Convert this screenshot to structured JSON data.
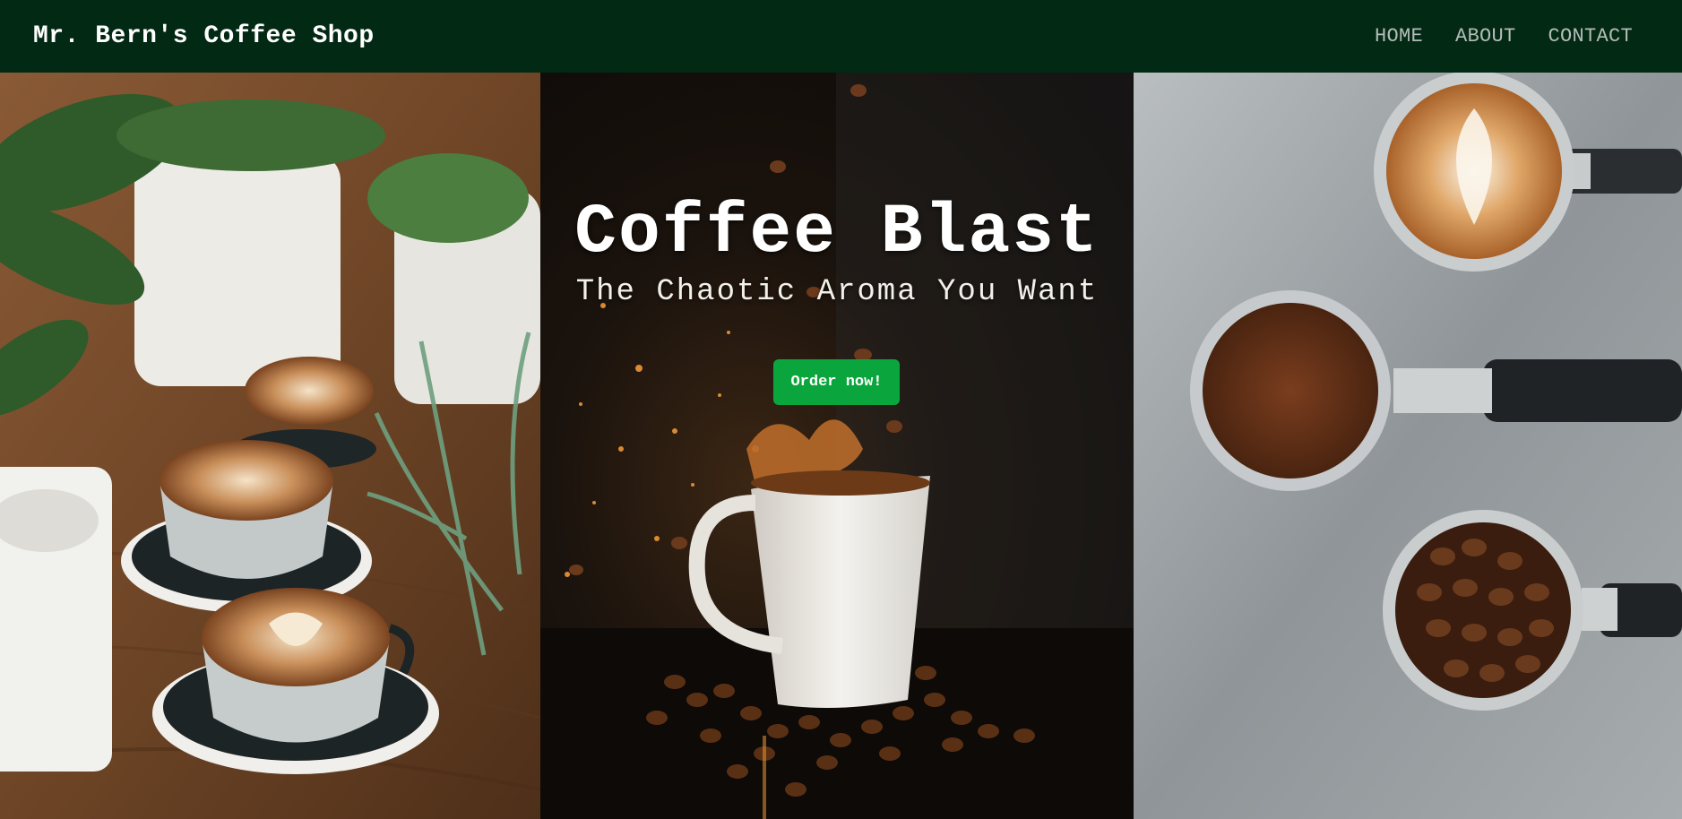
{
  "navbar": {
    "brand": "Mr. Bern's Coffee Shop",
    "links": [
      "HOME",
      "ABOUT",
      "CONTACT"
    ]
  },
  "hero": {
    "title": "Coffee Blast",
    "subtitle": "The Chaotic Aroma You Want",
    "cta_label": "Order now!"
  },
  "colors": {
    "navbar_bg": "#022914",
    "nav_link": "#b3bcb6",
    "cta_bg": "#0aa63d"
  },
  "images": [
    "latte-cups-with-plants-photo",
    "coffee-mug-splash-photo",
    "espresso-portafilters-photo"
  ]
}
